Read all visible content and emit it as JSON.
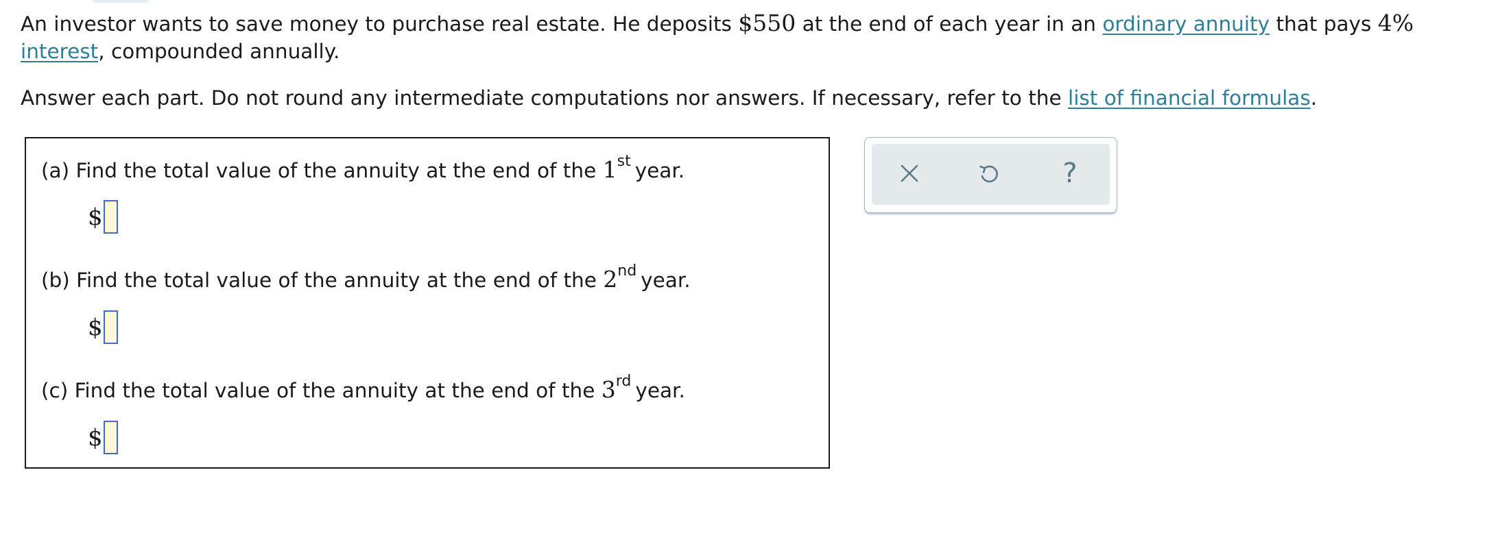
{
  "intro": {
    "p1": "An investor wants to save money to purchase real estate. He deposits ",
    "deposit": "$550",
    "p2": " at the end of each year in an ",
    "link_annuity": "ordinary annuity",
    "p3": " that pays ",
    "rate": "4%",
    "p4": " ",
    "link_interest": "interest",
    "p5": ", compounded annually."
  },
  "instructions": {
    "text": "Answer each part. Do not round any intermediate computations nor answers. If necessary, refer to the ",
    "link": "list of financial formulas",
    "end": "."
  },
  "parts": [
    {
      "prefix": "(a) Find the total value of the annuity at the end of the ",
      "ordinal": "1",
      "suffix_sup": "st",
      "after": "year.",
      "currency": "$",
      "value": ""
    },
    {
      "prefix": "(b) Find the total value of the annuity at the end of the ",
      "ordinal": "2",
      "suffix_sup": "nd",
      "after": "year.",
      "currency": "$",
      "value": ""
    },
    {
      "prefix": "(c) Find the total value of the annuity at the end of the ",
      "ordinal": "3",
      "suffix_sup": "rd",
      "after": "year.",
      "currency": "$",
      "value": ""
    }
  ],
  "toolbar": {
    "icons": [
      "close-icon",
      "undo-icon",
      "help-icon"
    ],
    "help_glyph": "?",
    "icon_color": "#5a7a86"
  }
}
